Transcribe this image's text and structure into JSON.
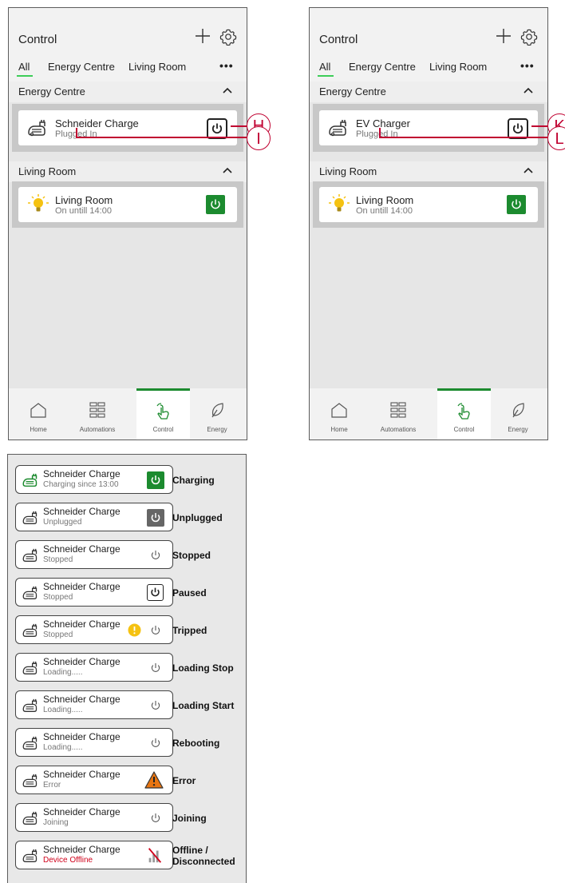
{
  "colors": {
    "accent_green": "#1c8b2f",
    "callout_red": "#c00030",
    "warning_yellow": "#f5c211",
    "error_orange": "#e87511",
    "offline_red": "#d0021b"
  },
  "left_phone": {
    "title": "Control",
    "tabs": [
      "All",
      "Energy Centre",
      "Living Room"
    ],
    "more": "•••",
    "sections": [
      {
        "label": "Energy Centre",
        "card": {
          "name": "Schneider Charge",
          "status": "Plugged In",
          "icon": "ev-charger-icon",
          "control": "power-outline"
        }
      },
      {
        "label": "Living Room",
        "card": {
          "name": "Living Room",
          "status": "On untill 14:00",
          "icon": "lightbulb-icon",
          "control": "power-green"
        }
      }
    ],
    "callouts": [
      "H",
      "I"
    ],
    "nav": [
      "Home",
      "Automations",
      "Control",
      "Energy"
    ]
  },
  "right_phone": {
    "title": "Control",
    "tabs": [
      "All",
      "Energy Centre",
      "Living Room"
    ],
    "more": "•••",
    "sections": [
      {
        "label": "Energy Centre",
        "card": {
          "name": "EV Charger",
          "status": "Plugged In",
          "icon": "ev-charger-icon",
          "control": "power-outline"
        }
      },
      {
        "label": "Living Room",
        "card": {
          "name": "Living Room",
          "status": "On untill 14:00",
          "icon": "lightbulb-icon",
          "control": "power-green"
        }
      }
    ],
    "callouts": [
      "K",
      "L"
    ],
    "nav": [
      "Home",
      "Automations",
      "Control",
      "Energy"
    ]
  },
  "states": [
    {
      "name": "Schneider Charge",
      "sub": "Charging since 13:00",
      "label": "Charging",
      "icon": "ev-charger-green-icon",
      "control": "power-green"
    },
    {
      "name": "Schneider Charge",
      "sub": "Unplugged",
      "label": "Unplugged",
      "icon": "ev-charger-icon",
      "control": "power-grey"
    },
    {
      "name": "Schneider Charge",
      "sub": "Stopped",
      "label": "Stopped",
      "icon": "ev-charger-icon",
      "control": "power-thin"
    },
    {
      "name": "Schneider Charge",
      "sub": "Stopped",
      "label": "Paused",
      "icon": "ev-charger-icon",
      "control": "power-outline"
    },
    {
      "name": "Schneider Charge",
      "sub": "Stopped",
      "label": "Tripped",
      "icon": "ev-charger-icon",
      "control": "power-thin-warning"
    },
    {
      "name": "Schneider Charge",
      "sub": "Loading.....",
      "label": "Loading Stop",
      "icon": "ev-charger-icon",
      "control": "power-thin"
    },
    {
      "name": "Schneider Charge",
      "sub": "Loading.....",
      "label": "Loading Start",
      "icon": "ev-charger-icon",
      "control": "power-thin"
    },
    {
      "name": "Schneider Charge",
      "sub": "Loading.....",
      "label": "Rebooting",
      "icon": "ev-charger-icon",
      "control": "power-thin"
    },
    {
      "name": "Schneider Charge",
      "sub": "Error",
      "label": "Error",
      "icon": "ev-charger-icon",
      "control": "error-triangle"
    },
    {
      "name": "Schneider Charge",
      "sub": "Joining",
      "label": "Joining",
      "icon": "ev-charger-icon",
      "control": "power-thin"
    },
    {
      "name": "Schneider Charge",
      "sub": "Device Offline",
      "label": "Offline / Disconnected",
      "icon": "ev-charger-icon",
      "control": "signal-off"
    }
  ]
}
